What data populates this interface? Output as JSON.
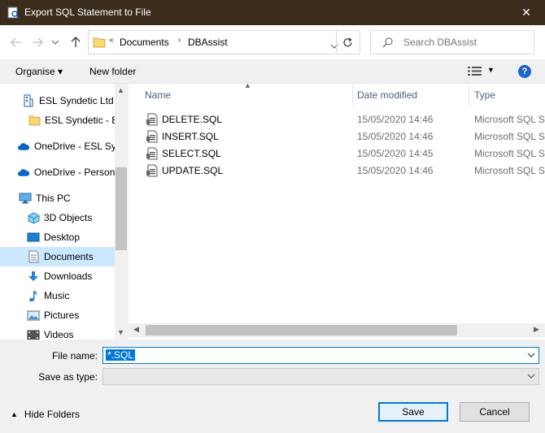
{
  "window": {
    "title": "Export SQL Statement to File",
    "close_glyph": "✕"
  },
  "address": {
    "overflow_glyph": "«",
    "crumbs": [
      "Documents",
      "DBAssist"
    ],
    "search_placeholder": "Search DBAssist"
  },
  "toolbar": {
    "organise": "Organise ▾",
    "new_folder": "New folder",
    "help": "?"
  },
  "nav": {
    "items": [
      {
        "label": "ESL Syndetic Ltd",
        "icon": "building-icon"
      },
      {
        "label": "ESL Syndetic - ESL",
        "icon": "folder-icon"
      },
      {
        "label": "OneDrive - ESL Syndetic Ltd",
        "icon": "cloud-icon"
      },
      {
        "label": "OneDrive - Personal",
        "icon": "cloud-icon"
      },
      {
        "label": "This PC",
        "icon": "computer-icon"
      },
      {
        "label": "3D Objects",
        "icon": "cube-icon"
      },
      {
        "label": "Desktop",
        "icon": "desktop-icon"
      },
      {
        "label": "Documents",
        "icon": "document-icon"
      },
      {
        "label": "Downloads",
        "icon": "download-icon"
      },
      {
        "label": "Music",
        "icon": "music-icon"
      },
      {
        "label": "Pictures",
        "icon": "pictures-icon"
      },
      {
        "label": "Videos",
        "icon": "video-icon"
      }
    ],
    "selected": "Documents"
  },
  "columns": {
    "name": "Name",
    "date": "Date modified",
    "type": "Type"
  },
  "files": [
    {
      "name": "DELETE.SQL",
      "date": "15/05/2020 14:46",
      "type": "Microsoft SQL Server Query File"
    },
    {
      "name": "INSERT.SQL",
      "date": "15/05/2020 14:46",
      "type": "Microsoft SQL Server Query File"
    },
    {
      "name": "SELECT.SQL",
      "date": "15/05/2020 14:45",
      "type": "Microsoft SQL Server Query File"
    },
    {
      "name": "UPDATE.SQL",
      "date": "15/05/2020 14:46",
      "type": "Microsoft SQL Server Query File"
    }
  ],
  "form": {
    "file_name_label": "File name:",
    "file_name_value": "*.SQL",
    "save_as_type_label": "Save as type:",
    "save_as_type_value": ""
  },
  "footer": {
    "hide_folders": "Hide Folders",
    "save": "Save",
    "cancel": "Cancel"
  },
  "colors": {
    "accent": "#0078d7",
    "titlebar": "#3a2d1c",
    "selected": "#cce8ff"
  }
}
